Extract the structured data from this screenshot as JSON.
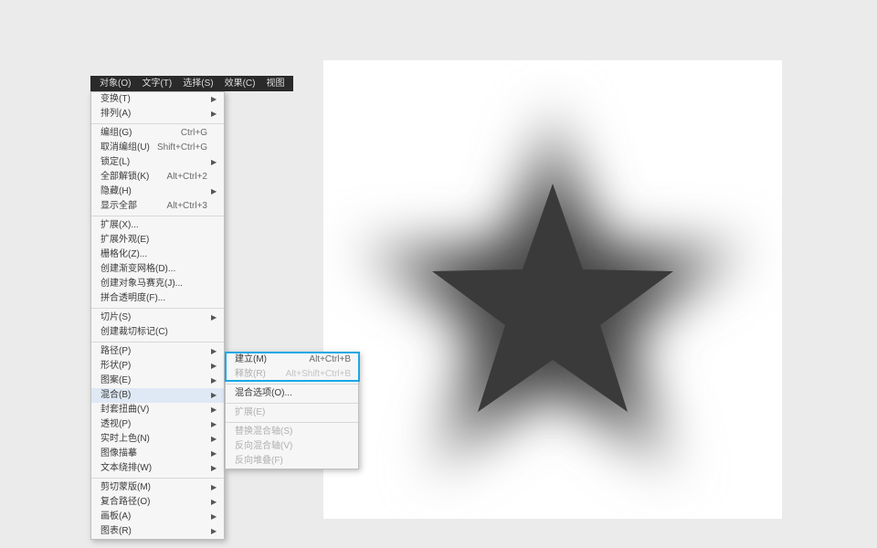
{
  "menubar": {
    "items": [
      "对象(O)",
      "文字(T)",
      "选择(S)",
      "效果(C)",
      "视图"
    ]
  },
  "dropdown": {
    "groups": [
      [
        {
          "label": "变换(T)",
          "shortcut": "",
          "arrow": true
        },
        {
          "label": "排列(A)",
          "shortcut": "",
          "arrow": true
        }
      ],
      [
        {
          "label": "编组(G)",
          "shortcut": "Ctrl+G",
          "arrow": false
        },
        {
          "label": "取消编组(U)",
          "shortcut": "Shift+Ctrl+G",
          "arrow": false
        },
        {
          "label": "锁定(L)",
          "shortcut": "",
          "arrow": true
        },
        {
          "label": "全部解锁(K)",
          "shortcut": "Alt+Ctrl+2",
          "arrow": false
        },
        {
          "label": "隐藏(H)",
          "shortcut": "",
          "arrow": true
        },
        {
          "label": "显示全部",
          "shortcut": "Alt+Ctrl+3",
          "arrow": false
        }
      ],
      [
        {
          "label": "扩展(X)...",
          "shortcut": "",
          "arrow": false
        },
        {
          "label": "扩展外观(E)",
          "shortcut": "",
          "arrow": false
        },
        {
          "label": "栅格化(Z)...",
          "shortcut": "",
          "arrow": false
        },
        {
          "label": "创建渐变网格(D)...",
          "shortcut": "",
          "arrow": false
        },
        {
          "label": "创建对象马赛克(J)...",
          "shortcut": "",
          "arrow": false
        },
        {
          "label": "拼合透明度(F)...",
          "shortcut": "",
          "arrow": false
        }
      ],
      [
        {
          "label": "切片(S)",
          "shortcut": "",
          "arrow": true
        },
        {
          "label": "创建裁切标记(C)",
          "shortcut": "",
          "arrow": false
        }
      ],
      [
        {
          "label": "路径(P)",
          "shortcut": "",
          "arrow": true
        },
        {
          "label": "形状(P)",
          "shortcut": "",
          "arrow": true
        },
        {
          "label": "图案(E)",
          "shortcut": "",
          "arrow": true
        },
        {
          "label": "混合(B)",
          "shortcut": "",
          "arrow": true,
          "highlight": true
        },
        {
          "label": "封套扭曲(V)",
          "shortcut": "",
          "arrow": true
        },
        {
          "label": "透视(P)",
          "shortcut": "",
          "arrow": true
        },
        {
          "label": "实时上色(N)",
          "shortcut": "",
          "arrow": true
        },
        {
          "label": "图像描摹",
          "shortcut": "",
          "arrow": true
        },
        {
          "label": "文本绕排(W)",
          "shortcut": "",
          "arrow": true
        }
      ],
      [
        {
          "label": "剪切蒙版(M)",
          "shortcut": "",
          "arrow": true
        },
        {
          "label": "复合路径(O)",
          "shortcut": "",
          "arrow": true
        },
        {
          "label": "画板(A)",
          "shortcut": "",
          "arrow": true
        },
        {
          "label": "图表(R)",
          "shortcut": "",
          "arrow": true
        }
      ]
    ]
  },
  "submenu": {
    "groups": [
      [
        {
          "label": "建立(M)",
          "shortcut": "Alt+Ctrl+B",
          "disabled": false
        },
        {
          "label": "释放(R)",
          "shortcut": "Alt+Shift+Ctrl+B",
          "disabled": true
        }
      ],
      [
        {
          "label": "混合选项(O)...",
          "shortcut": "",
          "disabled": false
        }
      ],
      [
        {
          "label": "扩展(E)",
          "shortcut": "",
          "disabled": true
        }
      ],
      [
        {
          "label": "替换混合轴(S)",
          "shortcut": "",
          "disabled": true
        },
        {
          "label": "反向混合轴(V)",
          "shortcut": "",
          "disabled": true
        },
        {
          "label": "反向堆叠(F)",
          "shortcut": "",
          "disabled": true
        }
      ]
    ]
  }
}
